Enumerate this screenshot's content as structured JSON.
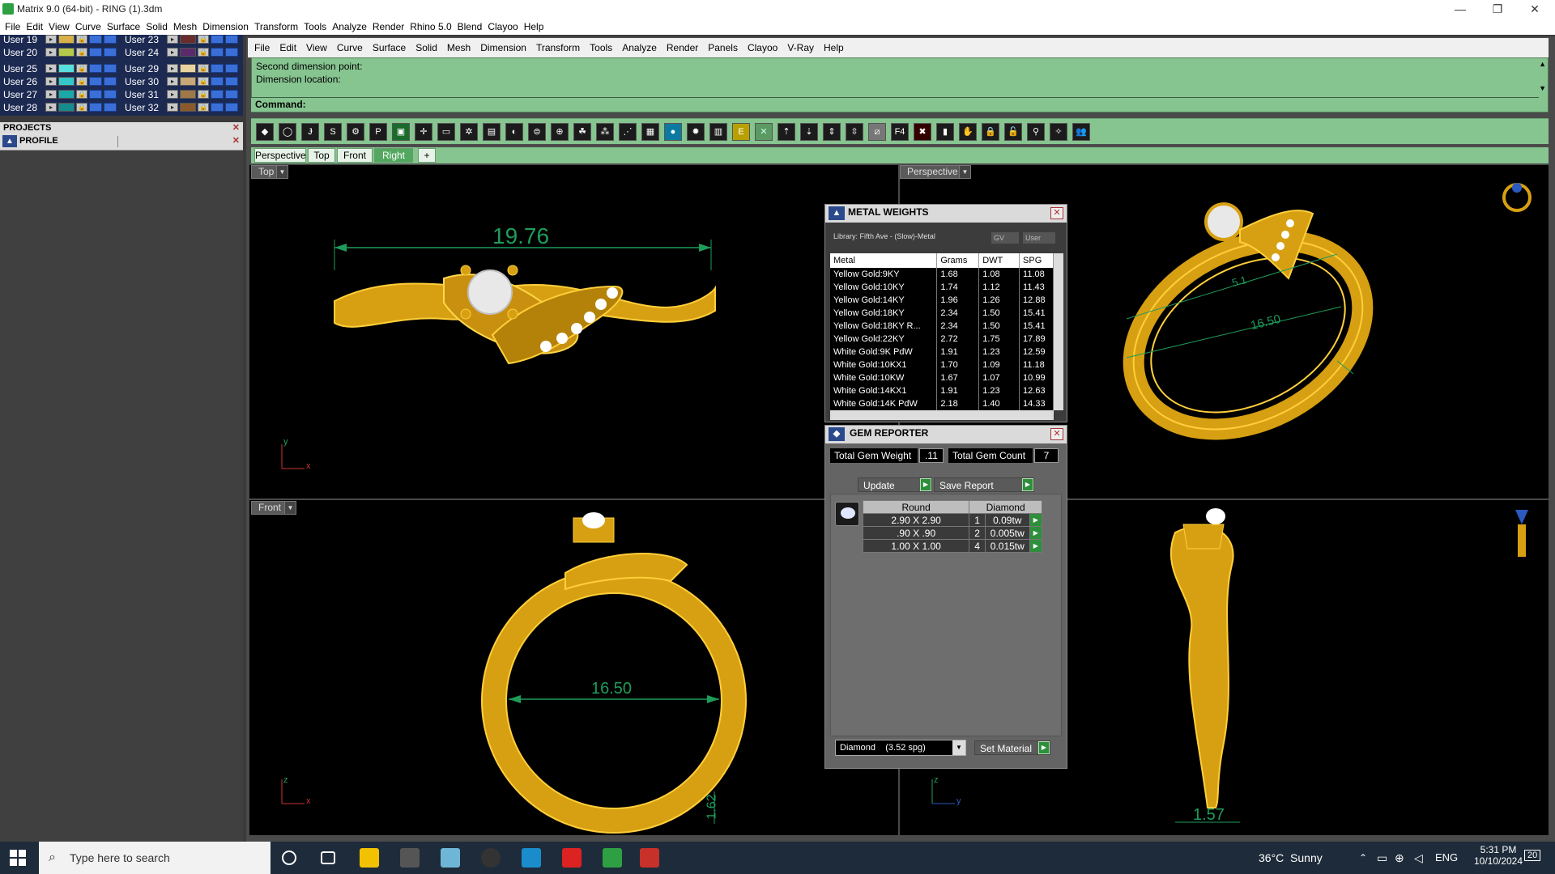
{
  "window": {
    "title": "Matrix 9.0 (64-bit) - RING (1).3dm",
    "minimize": "—",
    "restore": "❐",
    "close": "✕"
  },
  "main_menu": [
    "File",
    "Edit",
    "View",
    "Curve",
    "Surface",
    "Solid",
    "Mesh",
    "Dimension",
    "Transform",
    "Tools",
    "Analyze",
    "Render",
    "Rhino 5.0",
    "Blend",
    "Clayoo",
    "Help"
  ],
  "layers": {
    "left_col": [
      {
        "name": "User 19",
        "color": "#d7b04a"
      },
      {
        "name": "User 20",
        "color": "#b6c84a"
      },
      {
        "name": "User 25",
        "color": "#56e0e0"
      },
      {
        "name": "User 26",
        "color": "#34c8c8"
      },
      {
        "name": "User 27",
        "color": "#1aa8a8"
      },
      {
        "name": "User 28",
        "color": "#178c8c"
      }
    ],
    "right_col": [
      {
        "name": "User 23",
        "color": "#6a2d2d"
      },
      {
        "name": "User 24",
        "color": "#5a2a6a"
      },
      {
        "name": "User 29",
        "color": "#e8d2a0"
      },
      {
        "name": "User 30",
        "color": "#c8a878"
      },
      {
        "name": "User 31",
        "color": "#a07848"
      },
      {
        "name": "User 32",
        "color": "#8c5a2a"
      }
    ]
  },
  "projects": {
    "title": "PROJECTS",
    "profile": "PROFILE"
  },
  "inner_menu": [
    "File",
    "Edit",
    "View",
    "Curve",
    "Surface",
    "Solid",
    "Mesh",
    "Dimension",
    "Transform",
    "Tools",
    "Analyze",
    "Render",
    "Panels",
    "Clayoo",
    "V-Ray",
    "Help"
  ],
  "command": {
    "line1": "Second dimension point:",
    "line2": "Dimension location:",
    "prompt": "Command:"
  },
  "view_tabs": [
    "Perspective",
    "Top",
    "Front",
    "Right",
    "+"
  ],
  "viewports": {
    "top": {
      "label": "Top",
      "dim": "19.76",
      "axis_y": "y",
      "axis_x": "x"
    },
    "perspective": {
      "label": "Perspective",
      "dim": "16.50",
      "dim_small": "5.1"
    },
    "front": {
      "label": "Front",
      "dim": "16.50",
      "dim_side": "1.62",
      "axis_z": "z",
      "axis_x": "x"
    },
    "right": {
      "dim": "1.57",
      "axis_z": "z",
      "axis_y": "y"
    }
  },
  "metal_weights": {
    "title": "METAL WEIGHTS",
    "library": "Library: Fifth Ave - (Slow)-Metal",
    "gv": "GV",
    "user": "User",
    "columns": [
      "Metal",
      "Grams",
      "DWT",
      "SPG"
    ],
    "rows": [
      [
        "Yellow Gold:9KY",
        "1.68",
        "1.08",
        "11.08"
      ],
      [
        "Yellow Gold:10KY",
        "1.74",
        "1.12",
        "11.43"
      ],
      [
        "Yellow Gold:14KY",
        "1.96",
        "1.26",
        "12.88"
      ],
      [
        "Yellow Gold:18KY",
        "2.34",
        "1.50",
        "15.41"
      ],
      [
        "Yellow Gold:18KY R...",
        "2.34",
        "1.50",
        "15.41"
      ],
      [
        "Yellow Gold:22KY",
        "2.72",
        "1.75",
        "17.89"
      ],
      [
        "White Gold:9K PdW",
        "1.91",
        "1.23",
        "12.59"
      ],
      [
        "White Gold:10KX1",
        "1.70",
        "1.09",
        "11.18"
      ],
      [
        "White Gold:10KW",
        "1.67",
        "1.07",
        "10.99"
      ],
      [
        "White Gold:14KX1",
        "1.91",
        "1.23",
        "12.63"
      ],
      [
        "White Gold:14K PdW",
        "2.18",
        "1.40",
        "14.33"
      ]
    ]
  },
  "gem_reporter": {
    "title": "GEM REPORTER",
    "total_weight_label": "Total Gem Weight",
    "total_weight": ".11",
    "total_count_label": "Total Gem Count",
    "total_count": "7",
    "update": "Update",
    "save_report": "Save Report",
    "columns": [
      "Round",
      "",
      "Diamond",
      ""
    ],
    "rows": [
      [
        "2.90 X 2.90",
        "1",
        "0.09tw"
      ],
      [
        ".90 X .90",
        "2",
        "0.005tw"
      ],
      [
        "1.00 X 1.00",
        "4",
        "0.015tw"
      ]
    ],
    "material": "Diamond    (3.52 spg)",
    "set_material": "Set Material"
  },
  "taskbar": {
    "search_placeholder": "Type here to search",
    "weather": "36°C  Sunny",
    "lang": "ENG",
    "time": "5:31 PM",
    "date": "10/10/2024",
    "notif": "20"
  }
}
